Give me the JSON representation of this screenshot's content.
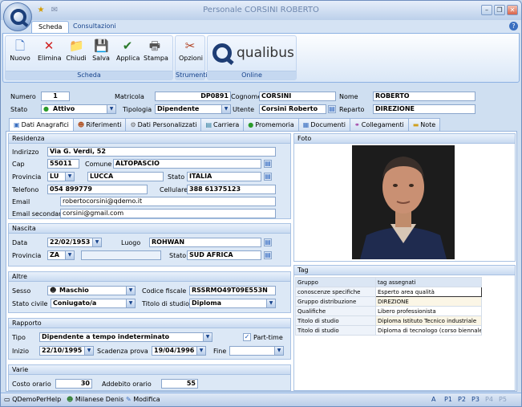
{
  "window": {
    "title": "Personale CORSINI ROBERTO"
  },
  "ribbon": {
    "tabs": [
      "Scheda",
      "Consultazioni"
    ],
    "groups": {
      "scheda": "Scheda",
      "strumenti": "Strumenti",
      "online": "Online"
    },
    "buttons": {
      "nuovo": "Nuovo",
      "elimina": "Elimina",
      "chiudi": "Chiudi",
      "salva": "Salva",
      "applica": "Applica",
      "stampa": "Stampa",
      "opzioni": "Opzioni"
    },
    "logo_text": "qualibus"
  },
  "header": {
    "numero_label": "Numero",
    "numero": "1",
    "matricola_label": "Matricola",
    "matricola": "DP0891",
    "cognome_label": "Cognome",
    "cognome": "CORSINI",
    "nome_label": "Nome",
    "nome": "ROBERTO",
    "stato_label": "Stato",
    "stato": "Attivo",
    "tipologia_label": "Tipologia",
    "tipologia": "Dipendente",
    "utente_label": "Utente",
    "utente": "Corsini Roberto",
    "reparto_label": "Reparto",
    "reparto": "DIREZIONE"
  },
  "detail_tabs": [
    "Dati Anagrafici",
    "Riferimenti",
    "Dati Personalizzati",
    "Carriera",
    "Promemoria",
    "Documenti",
    "Collegamenti",
    "Note"
  ],
  "residenza": {
    "title": "Residenza",
    "indirizzo_label": "Indirizzo",
    "indirizzo": "Via G. Verdi, 52",
    "cap_label": "Cap",
    "cap": "55011",
    "comune_label": "Comune",
    "comune": "ALTOPASCIO",
    "provincia_label": "Provincia",
    "provincia": "LU",
    "provincia_nome": "LUCCA",
    "stato_label": "Stato",
    "stato": "ITALIA",
    "telefono_label": "Telefono",
    "telefono": "054 899779",
    "cellulare_label": "Cellulare",
    "cellulare": "388 61375123",
    "email_label": "Email",
    "email": "robertocorsini@qdemo.it",
    "email2_label": "Email secondaria",
    "email2": "corsini@gmail.com"
  },
  "nascita": {
    "title": "Nascita",
    "data_label": "Data",
    "data": "22/02/1953",
    "luogo_label": "Luogo",
    "luogo": "ROHWAN",
    "provincia_label": "Provincia",
    "provincia": "ZA",
    "stato_label": "Stato",
    "stato": "SUD AFRICA"
  },
  "altre": {
    "title": "Altre",
    "sesso_label": "Sesso",
    "sesso": "Maschio",
    "cf_label": "Codice fiscale",
    "cf": "RSSRMO49T09E553N",
    "civile_label": "Stato civile",
    "civile": "Coniugato/a",
    "studio_label": "Titolo di studio",
    "studio": "Diploma"
  },
  "rapporto": {
    "title": "Rapporto",
    "tipo_label": "Tipo",
    "tipo": "Dipendente a tempo indeterminato",
    "parttime_label": "Part-time",
    "inizio_label": "Inizio",
    "inizio": "22/10/1995",
    "scadenza_label": "Scadenza prova",
    "scadenza": "19/04/1996",
    "fine_label": "Fine"
  },
  "varie": {
    "title": "Varie",
    "costo_label": "Costo orario",
    "costo": "30",
    "addebito_label": "Addebito orario",
    "addebito": "55"
  },
  "foto": {
    "title": "Foto"
  },
  "tag": {
    "title": "Tag",
    "headers": [
      "Gruppo",
      "tag assegnati"
    ],
    "rows": [
      {
        "gruppo": "conoscenze specifiche",
        "tag": "Esperto area qualità"
      },
      {
        "gruppo": "Gruppo distribuzione",
        "tag": "DIREZIONE"
      },
      {
        "gruppo": "Qualifiche",
        "tag": "Libero professionista"
      },
      {
        "gruppo": "Titolo di studio",
        "tag": "Diploma Istituto Tecnico industriale"
      },
      {
        "gruppo": "Titolo di studio",
        "tag": "Diploma di tecnologo (corso biennale p"
      }
    ]
  },
  "status": {
    "app": "QDemoPerHelp",
    "user": "Milanese Denis",
    "mode": "Modifica",
    "pages": [
      "A",
      "P1",
      "P2",
      "P3",
      "P4",
      "P5"
    ]
  }
}
